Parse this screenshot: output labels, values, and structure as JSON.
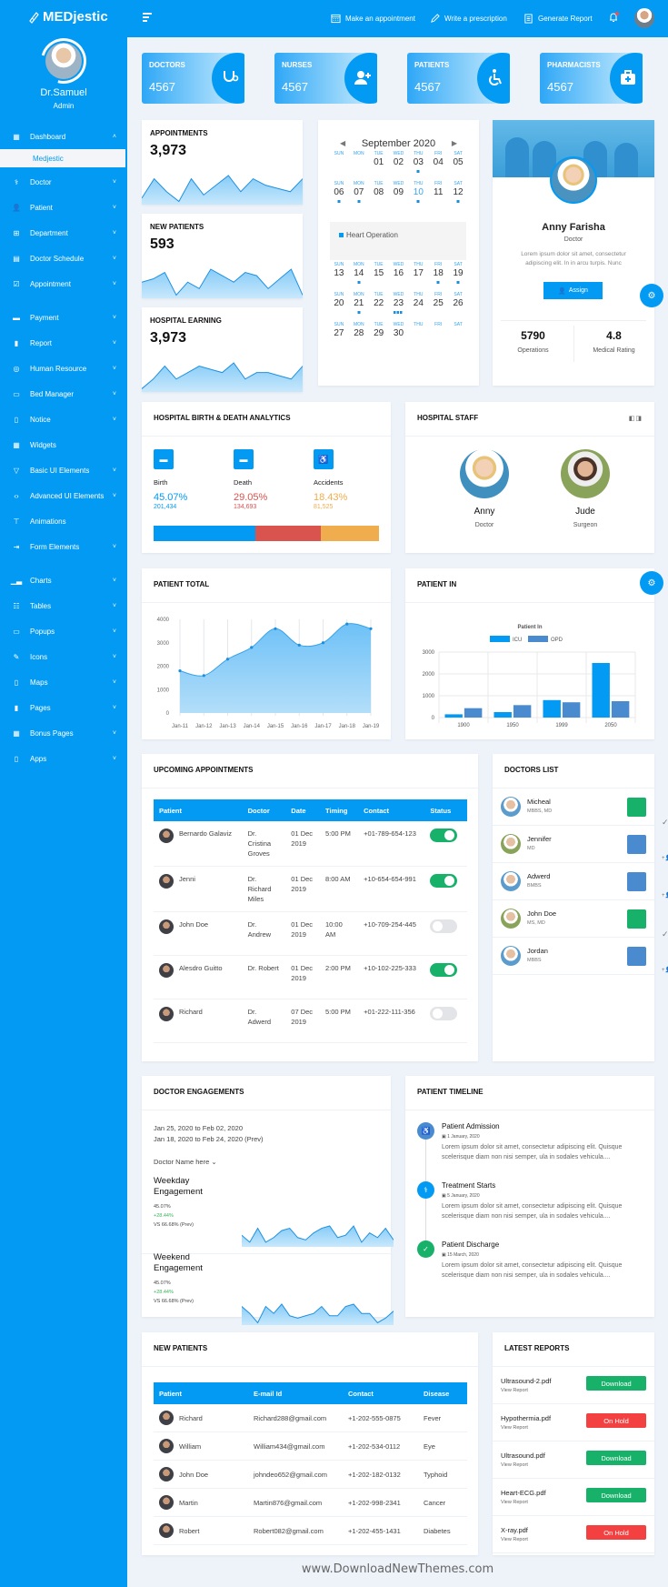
{
  "sidebar": {
    "brand": "MEDjestic",
    "profile": {
      "name": "Dr.Samuel",
      "role": "Admin"
    },
    "items": [
      {
        "label": "Dashboard",
        "icon": "dashboard-icon",
        "chevron": "up"
      },
      {
        "label": "Doctor",
        "icon": "stethoscope-icon",
        "chevron": "down"
      },
      {
        "label": "Patient",
        "icon": "user-icon",
        "chevron": "down"
      },
      {
        "label": "Department",
        "icon": "sitemap-icon",
        "chevron": "down"
      },
      {
        "label": "Doctor Schedule",
        "icon": "schedule-icon",
        "chevron": "down"
      },
      {
        "label": "Appointment",
        "icon": "check-square-icon",
        "chevron": "down"
      },
      {
        "label": "Payment",
        "icon": "credit-card-icon",
        "chevron": "down"
      },
      {
        "label": "Report",
        "icon": "file-icon",
        "chevron": "down"
      },
      {
        "label": "Human Resource",
        "icon": "lifebuoy-icon",
        "chevron": "down"
      },
      {
        "label": "Bed Manager",
        "icon": "bed-icon",
        "chevron": "down"
      },
      {
        "label": "Notice",
        "icon": "notice-icon",
        "chevron": "down"
      },
      {
        "label": "Widgets",
        "icon": "widgets-icon",
        "chevron": ""
      },
      {
        "label": "Basic UI Elements",
        "icon": "filter-icon",
        "chevron": "down"
      },
      {
        "label": "Advanced UI Elements",
        "icon": "code-icon",
        "chevron": "down"
      },
      {
        "label": "Animations",
        "icon": "paint-roller-icon",
        "chevron": ""
      },
      {
        "label": "Form Elements",
        "icon": "sign-in-icon",
        "chevron": "down"
      },
      {
        "label": "Charts",
        "icon": "bar-chart-icon",
        "chevron": "down"
      },
      {
        "label": "Tables",
        "icon": "table-icon",
        "chevron": "down"
      },
      {
        "label": "Popups",
        "icon": "comment-icon",
        "chevron": "down"
      },
      {
        "label": "Icons",
        "icon": "pen-icon",
        "chevron": "down"
      },
      {
        "label": "Maps",
        "icon": "map-icon",
        "chevron": "down"
      },
      {
        "label": "Pages",
        "icon": "page-icon",
        "chevron": "down"
      },
      {
        "label": "Bonus Pages",
        "icon": "grid-icon",
        "chevron": "down"
      },
      {
        "label": "Apps",
        "icon": "mobile-icon",
        "chevron": "down"
      }
    ],
    "active_sub": "Medjestic"
  },
  "topbar": {
    "make_appointment": "Make an appointment",
    "write_prescription": "Write a prescription",
    "generate_report": "Generate Report"
  },
  "stats": [
    {
      "label": "DOCTORS",
      "value": "4567",
      "icon": "stethoscope-icon"
    },
    {
      "label": "NURSES",
      "value": "4567",
      "icon": "user-plus-icon"
    },
    {
      "label": "PATIENTS",
      "value": "4567",
      "icon": "wheelchair-icon"
    },
    {
      "label": "PHARMACISTS",
      "value": "4567",
      "icon": "medkit-icon"
    }
  ],
  "mini_cards": [
    {
      "title": "APPOINTMENTS",
      "value": "3,973",
      "spark": [
        2,
        8,
        4,
        1,
        8,
        3,
        6,
        9,
        4,
        8,
        6,
        5,
        4,
        8
      ]
    },
    {
      "title": "NEW PATIENTS",
      "value": "593",
      "spark": [
        5,
        6,
        8,
        1,
        5,
        3,
        9,
        7,
        5,
        8,
        7,
        3,
        6,
        9,
        1
      ]
    },
    {
      "title": "HOSPITAL EARNING",
      "value": "3,973",
      "spark": [
        1,
        4,
        8,
        4,
        6,
        8,
        7,
        6,
        9,
        4,
        6,
        6,
        5,
        4,
        8
      ]
    }
  ],
  "calendar": {
    "month": "September 2020",
    "day_names": [
      "SUN",
      "MON",
      "TUE",
      "WED",
      "THU",
      "FRI",
      "SAT"
    ],
    "weeks": [
      [
        {
          "d": ""
        },
        {
          "d": ""
        },
        {
          "d": "01"
        },
        {
          "d": "02"
        },
        {
          "d": "03",
          "ev": 1
        },
        {
          "d": "04"
        },
        {
          "d": "05"
        }
      ],
      [
        {
          "d": "06",
          "ev": 1
        },
        {
          "d": "07",
          "ev": 1
        },
        {
          "d": "08"
        },
        {
          "d": "09"
        },
        {
          "d": "10",
          "ev": 1,
          "sel": true
        },
        {
          "d": "11"
        },
        {
          "d": "12",
          "ev": 1
        }
      ],
      [
        {
          "d": "13"
        },
        {
          "d": "14",
          "ev": 1
        },
        {
          "d": "15"
        },
        {
          "d": "16"
        },
        {
          "d": "17"
        },
        {
          "d": "18",
          "ev": 1
        },
        {
          "d": "19",
          "ev": 1
        }
      ],
      [
        {
          "d": "20"
        },
        {
          "d": "21",
          "ev": 1
        },
        {
          "d": "22"
        },
        {
          "d": "23",
          "ev": 3
        },
        {
          "d": "24"
        },
        {
          "d": "25"
        },
        {
          "d": "26"
        }
      ],
      [
        {
          "d": "27"
        },
        {
          "d": "28"
        },
        {
          "d": "29"
        },
        {
          "d": "30"
        },
        {
          "d": ""
        },
        {
          "d": ""
        },
        {
          "d": ""
        }
      ]
    ],
    "event": "Heart Operation"
  },
  "profile_card": {
    "name": "Anny Farisha",
    "role": "Doctor",
    "description": "Lorem ipsum dolor sit amet, consectetur adipiscing elit. In in arcu turpis. Nunc",
    "assign_label": "Assign",
    "stats": [
      {
        "value": "5790",
        "label": "Operations"
      },
      {
        "value": "4.8",
        "label": "Medical Rating"
      }
    ]
  },
  "birth_death": {
    "title": "HOSPITAL BIRTH & DEATH ANALYTICS",
    "items": [
      {
        "label": "Birth",
        "percent": "45.07%",
        "count": "201,434",
        "color": "#039af4",
        "share": 45.07
      },
      {
        "label": "Death",
        "percent": "29.05%",
        "count": "134,693",
        "color": "#d9534f",
        "share": 29.05
      },
      {
        "label": "Accidents",
        "percent": "18.43%",
        "count": "81,525",
        "color": "#f0ad4e",
        "share": 25.88
      }
    ]
  },
  "hospital_staff": {
    "title": "HOSPITAL STAFF",
    "members": [
      {
        "name": "Anny",
        "role": "Doctor"
      },
      {
        "name": "Jude",
        "role": "Surgeon"
      }
    ]
  },
  "chart_data": [
    {
      "type": "area",
      "title": "PATIENT TOTAL",
      "x": [
        "Jan-11",
        "Jan-12",
        "Jan-13",
        "Jan-14",
        "Jan-15",
        "Jan-16",
        "Jan-17",
        "Jan-18",
        "Jan-19"
      ],
      "values": [
        1800,
        1600,
        2300,
        2800,
        3600,
        2900,
        3000,
        3800,
        3600
      ],
      "yticks": [
        0,
        1000,
        2000,
        3000,
        4000
      ],
      "ylim": [
        0,
        4000
      ],
      "grid": "vertical",
      "xlabel": "",
      "ylabel": ""
    },
    {
      "type": "bar",
      "title": "PATIENT IN",
      "subtitle": "Patient In",
      "categories": [
        "1900",
        "1950",
        "1999",
        "2050"
      ],
      "series": [
        {
          "name": "ICU",
          "color": "#039af4",
          "values": [
            150,
            250,
            800,
            2500
          ]
        },
        {
          "name": "OPD",
          "color": "#4a8bd0",
          "values": [
            430,
            570,
            700,
            750
          ]
        }
      ],
      "yticks": [
        0,
        1000,
        2000,
        3000
      ],
      "ylim": [
        0,
        3000
      ],
      "legend": "top",
      "xlabel": "",
      "ylabel": ""
    }
  ],
  "appointments": {
    "title": "UPCOMING APPOINTMENTS",
    "columns": [
      "Patient",
      "Doctor",
      "Date",
      "Timing",
      "Contact",
      "Status"
    ],
    "rows": [
      {
        "patient": "Bernardo Galaviz",
        "doctor": "Dr. Cristina Groves",
        "date": "01 Dec 2019",
        "time": "5:00 PM",
        "contact": "+01-789-654-123",
        "status": true
      },
      {
        "patient": "Jenni",
        "doctor": "Dr. Richard Miles",
        "date": "01 Dec 2019",
        "time": "8:00 AM",
        "contact": "+10-654-654-991",
        "status": true
      },
      {
        "patient": "John Doe",
        "doctor": "Dr. Andrew",
        "date": "01 Dec 2019",
        "time": "10:00 AM",
        "contact": "+10-709-254-445",
        "status": false
      },
      {
        "patient": "Alesdro Guitto",
        "doctor": "Dr. Robert",
        "date": "01 Dec 2019",
        "time": "2:00 PM",
        "contact": "+10-102-225-333",
        "status": true
      },
      {
        "patient": "Richard",
        "doctor": "Dr. Adwerd",
        "date": "07 Dec 2019",
        "time": "5:00 PM",
        "contact": "+01-222-111-356",
        "status": false
      }
    ]
  },
  "doctors_list": {
    "title": "DOCTORS LIST",
    "items": [
      {
        "name": "Micheal",
        "degree": "MBBS, MD",
        "action": "check"
      },
      {
        "name": "Jennifer",
        "degree": "MD",
        "action": "add"
      },
      {
        "name": "Adwerd",
        "degree": "BMBS",
        "action": "add"
      },
      {
        "name": "John Doe",
        "degree": "MS, MD",
        "action": "check"
      },
      {
        "name": "Jordan",
        "degree": "MBBS",
        "action": "add"
      }
    ]
  },
  "engagements": {
    "title": "DOCTOR ENGAGEMENTS",
    "range_current": "Jan 25, 2020 to Feb 02, 2020",
    "range_prev": "Jan 18, 2020 to Feb 24, 2020 (Prev)",
    "doctor_select": "Doctor Name here",
    "blocks": [
      {
        "title": "Weekday Engagement",
        "value": "45.07%",
        "change": "+28.44%",
        "prev": "VS 66.68% (Prev)",
        "spark": [
          5,
          2,
          8,
          2,
          4,
          7,
          8,
          4,
          3,
          6,
          8,
          9,
          4,
          5,
          9,
          2,
          6,
          4,
          8,
          3
        ]
      },
      {
        "title": "Weekend Engagement",
        "value": "45.07%",
        "change": "+28.44%",
        "prev": "VS 66.68% (Prev)",
        "spark": [
          8,
          5,
          1,
          8,
          5,
          9,
          4,
          3,
          4,
          5,
          8,
          4,
          4,
          8,
          9,
          5,
          5,
          1,
          3,
          6
        ]
      }
    ]
  },
  "timeline": {
    "title": "PATIENT TIMELINE",
    "items": [
      {
        "title": "Patient Admission",
        "date": "1 January, 2020",
        "text": "Lorem ipsum dolor sit amet, consectetur adipiscing elit. Quisque scelerisque diam non nisi semper, ula in sodales vehicula....",
        "color": "#4a8bd0",
        "icon": "wheelchair-icon"
      },
      {
        "title": "Treatment Starts",
        "date": "5 January, 2020",
        "text": "Lorem ipsum dolor sit amet, consectetur adipiscing elit. Quisque scelerisque diam non nisi semper, ula in sodales vehicula....",
        "color": "#039af4",
        "icon": "doctor-icon"
      },
      {
        "title": "Patient Discharge",
        "date": "15 March, 2020",
        "text": "Lorem ipsum dolor sit amet, consectetur adipiscing elit. Quisque scelerisque diam non nisi semper, ula in sodales vehicula....",
        "color": "#17b16a",
        "icon": "check-icon"
      }
    ]
  },
  "new_patients": {
    "title": "NEW PATIENTS",
    "columns": [
      "Patient",
      "E-mail Id",
      "Contact",
      "Disease"
    ],
    "rows": [
      {
        "patient": "Richard",
        "email": "Richard288@gmail.com",
        "contact": "+1-202-555-0875",
        "disease": "Fever"
      },
      {
        "patient": "William",
        "email": "William434@gmail.com",
        "contact": "+1-202-534-0112",
        "disease": "Eye"
      },
      {
        "patient": "John Doe",
        "email": "johndeo652@gmail.com",
        "contact": "+1-202-182-0132",
        "disease": "Typhoid"
      },
      {
        "patient": "Martin",
        "email": "Martin876@gmail.com",
        "contact": "+1-202-998-2341",
        "disease": "Cancer"
      },
      {
        "patient": "Robert",
        "email": "Robert082@gmail.com",
        "contact": "+1-202-455-1431",
        "disease": "Diabetes"
      }
    ]
  },
  "reports": {
    "title": "LATEST REPORTS",
    "view_label": "View Report",
    "items": [
      {
        "file": "Ultrasound-2.pdf",
        "action": "Download",
        "color": "#17b16a"
      },
      {
        "file": "Hypothermia.pdf",
        "action": "On Hold",
        "color": "#f34141"
      },
      {
        "file": "Ultrasound.pdf",
        "action": "Download",
        "color": "#17b16a"
      },
      {
        "file": "Heart-ECG.pdf",
        "action": "Download",
        "color": "#17b16a"
      },
      {
        "file": "X-ray.pdf",
        "action": "On Hold",
        "color": "#f34141"
      }
    ]
  },
  "watermark": "www.DownloadNewThemes.com"
}
